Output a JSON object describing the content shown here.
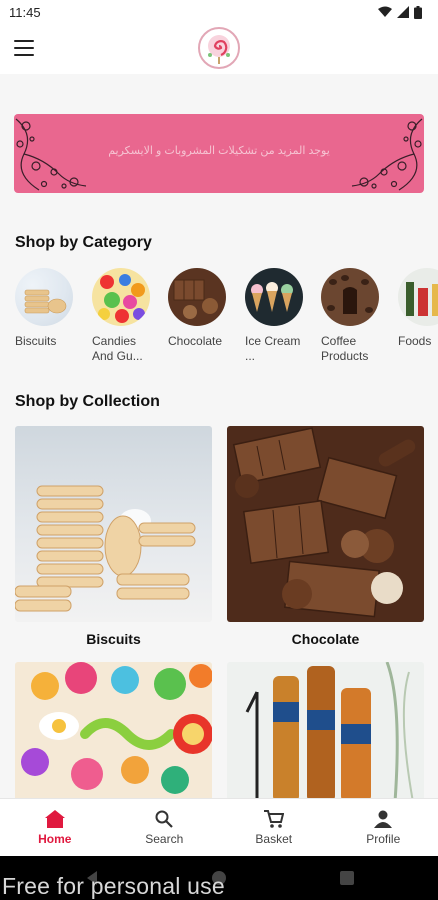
{
  "status": {
    "time": "11:45"
  },
  "banner": {
    "text": "يوجد المزيد من تشكيلات المشروبات و الايسكريم"
  },
  "sections": {
    "category_title": "Shop by Category",
    "collection_title": "Shop by Collection"
  },
  "categories": [
    {
      "label": "Biscuits"
    },
    {
      "label": "Candies And Gu..."
    },
    {
      "label": "Chocolate"
    },
    {
      "label": "Ice Cream ..."
    },
    {
      "label": "Coffee Products"
    },
    {
      "label": "Foods"
    }
  ],
  "collections": [
    {
      "label": "Biscuits"
    },
    {
      "label": "Chocolate"
    },
    {
      "label": ""
    },
    {
      "label": ""
    }
  ],
  "bottom_nav": [
    {
      "label": "Home",
      "icon": "home-icon",
      "active": true
    },
    {
      "label": "Search",
      "icon": "search-icon"
    },
    {
      "label": "Basket",
      "icon": "basket-icon"
    },
    {
      "label": "Profile",
      "icon": "profile-icon"
    }
  ],
  "watermark": "Free for personal use",
  "colors": {
    "accent": "#e0193f",
    "banner": "#e9678f"
  }
}
